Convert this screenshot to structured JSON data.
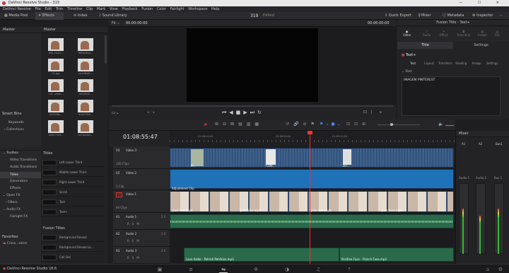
{
  "window": {
    "title": "DaVinci Resolve Studio - 319"
  },
  "menu": [
    "DaVinci Resolve",
    "File",
    "Edit",
    "Trim",
    "Timeline",
    "Clip",
    "Mark",
    "View",
    "Playback",
    "Fusion",
    "Color",
    "Fairlight",
    "Workspace",
    "Help"
  ],
  "toolbar": {
    "media_pool": "Media Pool",
    "effects": "Effects",
    "index": "Index",
    "sound_library": "Sound Library",
    "project": "319",
    "edited": "Edited",
    "quick_export": "Quick Export",
    "mixer": "Mixer",
    "metadata": "Metadata",
    "inspector": "Inspector"
  },
  "left": {
    "master_header": "Master",
    "bins_header": "Master",
    "smart_bins": "Smart Bins",
    "keywords": "Keywords",
    "collections": "Collections"
  },
  "media_clips": [
    "IMG_0422...",
    "REDEditor...",
    "01.jpg",
    "ce1dfb45...",
    "1Cf...wide...",
    "Sn0frfeb...",
    "iAChlSNs...",
    "9cfcD7bd...",
    "0NJ1T7a9...",
    "a27bd3e5..."
  ],
  "effects_tree": [
    {
      "label": "Toolbox",
      "indent": 0
    },
    {
      "label": "Video Transitions",
      "indent": 1
    },
    {
      "label": "Audio Transitions",
      "indent": 1
    },
    {
      "label": "Titles",
      "indent": 1,
      "active": true
    },
    {
      "label": "Generators",
      "indent": 1
    },
    {
      "label": "Effects",
      "indent": 1
    },
    {
      "label": "Open FX",
      "indent": 0
    },
    {
      "label": "Filters",
      "indent": 1
    },
    {
      "label": "Audio FX",
      "indent": 0
    },
    {
      "label": "Fairlight FX",
      "indent": 1
    }
  ],
  "favorites": {
    "header": "Favorites",
    "item": "Cross...solve"
  },
  "titles_header": "Titles",
  "titles_list": [
    "Left Lower Third",
    "Middle Lower Third",
    "Right Lower Third",
    "Scroll",
    "Text",
    "Text+"
  ],
  "fusion_titles_header": "Fusion Titles",
  "fusion_titles": [
    "Background Reveal",
    "Background Reveal Lo...",
    "Call Out"
  ],
  "viewer": {
    "fit": "Fit",
    "src_tc": "00:00:00:00",
    "rec_tc": "00:00:00:00",
    "page_label": "Timeline"
  },
  "timeline": {
    "timecode": "01:08:55:47",
    "ruler": [
      "01:08:00:00",
      "01:08:56:00",
      "01:09:12:00"
    ],
    "tracks": [
      {
        "id": "V3",
        "name": "Video 3",
        "clips": "145 Clips"
      },
      {
        "id": "V2",
        "name": "Video 2",
        "clips": "1 Clip"
      },
      {
        "id": "V1",
        "name": "Video 1",
        "clips": "44 Clips"
      },
      {
        "id": "A1",
        "name": "Audio 1",
        "level": "2.0"
      },
      {
        "id": "A2",
        "name": "Audio 2",
        "level": "2.0"
      },
      {
        "id": "A3",
        "name": "Audio 3",
        "level": "2.0"
      }
    ],
    "adjustment_clip": "Adjustment Clip",
    "clip_names": [
      "Pr...",
      "CON...",
      "Dri...",
      "pixo fono.mp4"
    ],
    "audio_a3_1": "Love Aside - Patrick Patrikios.mp3",
    "audio_a3_2": "Positive Fuse - French Fuse.mp3"
  },
  "inspector": {
    "header": "Fusion Title - Text+",
    "tabs": [
      "Video",
      "Audio",
      "Effect",
      "Transition",
      "Image",
      "File"
    ],
    "subtabs": [
      "Title",
      "Settings"
    ],
    "node": "Text+",
    "node_tabs": [
      "Text",
      "Layout",
      "Transform",
      "Shading",
      "Image",
      "Settings"
    ],
    "section": "Text",
    "text_value": "IMAGEM PINTEREST"
  },
  "mixer": {
    "header": "Mixer",
    "channels": [
      "A1",
      "A2",
      "Bus1"
    ],
    "audio_labels": [
      "Audio 1",
      "Audio 2",
      "Bus 1"
    ]
  },
  "status": {
    "app": "DaVinci Resolve Studio 18.6"
  }
}
